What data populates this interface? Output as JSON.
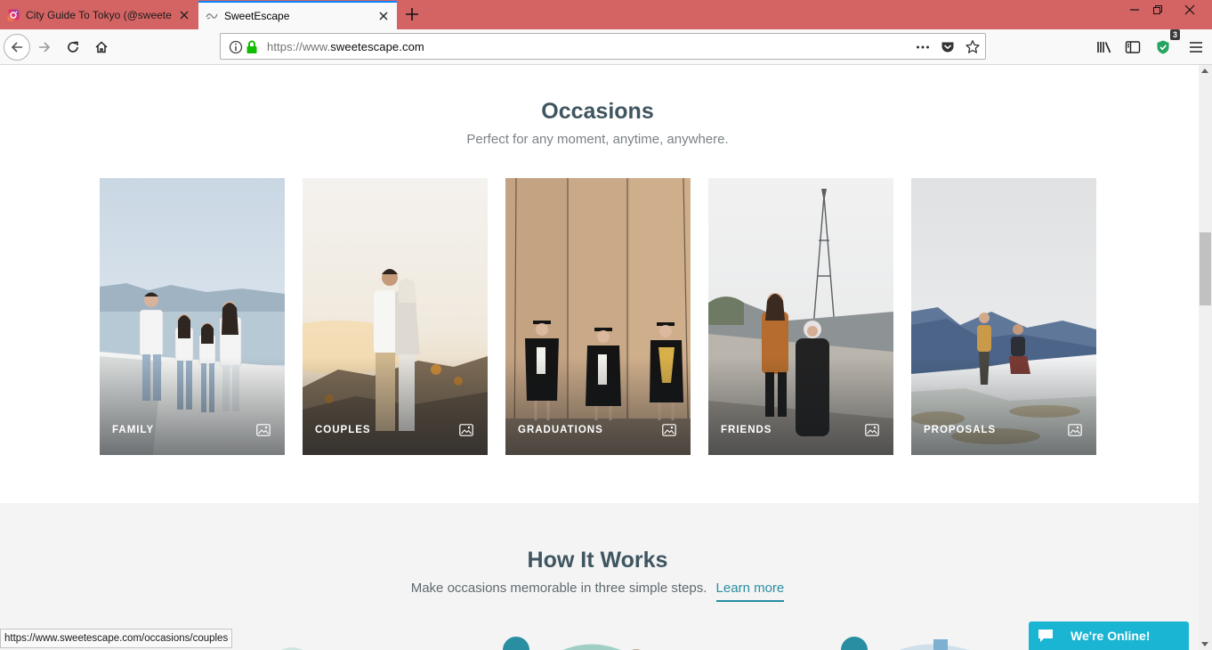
{
  "browser": {
    "tabs": [
      {
        "title": "City Guide To Tokyo (@sweete",
        "active": false
      },
      {
        "title": "SweetEscape",
        "active": true
      }
    ],
    "url_prefix": "https://www.",
    "url_host": "sweetescape.com",
    "toolbar_badge": "3",
    "status_url": "https://www.sweetescape.com/occasions/couples"
  },
  "occasions": {
    "title": "Occasions",
    "subtitle": "Perfect for any moment, anytime, anywhere.",
    "cards": [
      {
        "label": "FAMILY"
      },
      {
        "label": "COUPLES"
      },
      {
        "label": "GRADUATIONS"
      },
      {
        "label": "FRIENDS"
      },
      {
        "label": "PROPOSALS"
      }
    ]
  },
  "how_it_works": {
    "title": "How It Works",
    "subtitle": "Make occasions memorable in three simple steps.",
    "learn_more": "Learn more"
  },
  "chat": {
    "label": "We're Online!"
  },
  "colors": {
    "tabstrip": "#d46464",
    "accent_teal": "#2a8ea3",
    "chat": "#1ab5d3",
    "heading": "#3f5560"
  }
}
